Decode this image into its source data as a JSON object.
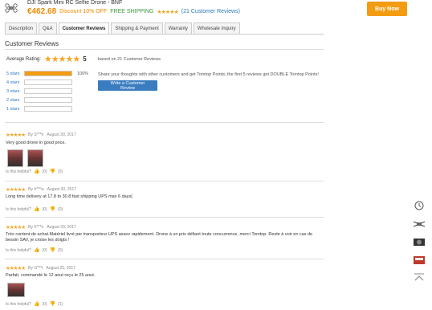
{
  "product": {
    "title": "DJI Spark Mini RC Selfie Drone - BNF",
    "price": "€462.68",
    "discount": "Discount 10% OFF",
    "shipping": "FREE SHIPPING",
    "stars": "★★★★★",
    "reviews_link": "(21 Customer Reviews)",
    "buy_label": "Buy Now"
  },
  "tabs": [
    {
      "label": "Description"
    },
    {
      "label": "Q&A"
    },
    {
      "label": "Customer Reviews"
    },
    {
      "label": "Shipping & Payment"
    },
    {
      "label": "Warranty"
    },
    {
      "label": "Wholesale Inquiry"
    }
  ],
  "summary": {
    "title": "Customer Reviews",
    "avg_label": "Average Rating:",
    "avg_stars": "★★★★★",
    "avg_value": "5",
    "based_on": "based on 21 Customer Reviews",
    "bars": [
      {
        "label": "5 stars",
        "percent": 100,
        "percent_text": "100%"
      },
      {
        "label": "4 stars",
        "percent": 0,
        "percent_text": ""
      },
      {
        "label": "3 stars",
        "percent": 0,
        "percent_text": ""
      },
      {
        "label": "2 stars",
        "percent": 0,
        "percent_text": ""
      },
      {
        "label": "1 stars",
        "percent": 0,
        "percent_text": ""
      }
    ],
    "share_text": "Share your thoughts with other customers and get Tomtop Points, the first 5 reviews get DOUBLE Tomtop Points!",
    "write_label": "Write a Customer Review"
  },
  "reviews": [
    {
      "stars": "★★★★★",
      "by": "By S***h",
      "date": "August 30, 2017",
      "text": "Very good drone in good price.",
      "helpful": "Is this helpful?",
      "yes": "(0)",
      "no": "(0)"
    },
    {
      "stars": "★★★★★",
      "by": "By h***w",
      "date": "August 30, 2017",
      "text": "Long time delivery at 17.8 to 30.8 fast shipping UPS max 6 days(",
      "helpful": "Is this helpful?",
      "yes": "(0)",
      "no": "(0)"
    },
    {
      "stars": "★★★★★",
      "by": "By K***n",
      "date": "August 29, 2017",
      "text": "Très content de achat.Matériel livré par transporteur UPS assez rapidement. Drone à un prix défiant toute concurrence, merci Tomtop. Reste à voir en cas de besoin SAV, je croise les doigts !",
      "helpful": "Is this helpful?",
      "yes": "(0)",
      "no": "(0)"
    },
    {
      "stars": "★★★★★",
      "by": "By G***t",
      "date": "August 25, 2017",
      "text": "Parfait, commandé le 12 aout reçu le 25 aout.",
      "helpful": "Is this helpful?",
      "yes": "(0)",
      "no": "(1)"
    }
  ],
  "side_icons": [
    "history-icon",
    "drone-icon",
    "camera-icon",
    "memory-card-icon",
    "back-to-top-icon"
  ]
}
